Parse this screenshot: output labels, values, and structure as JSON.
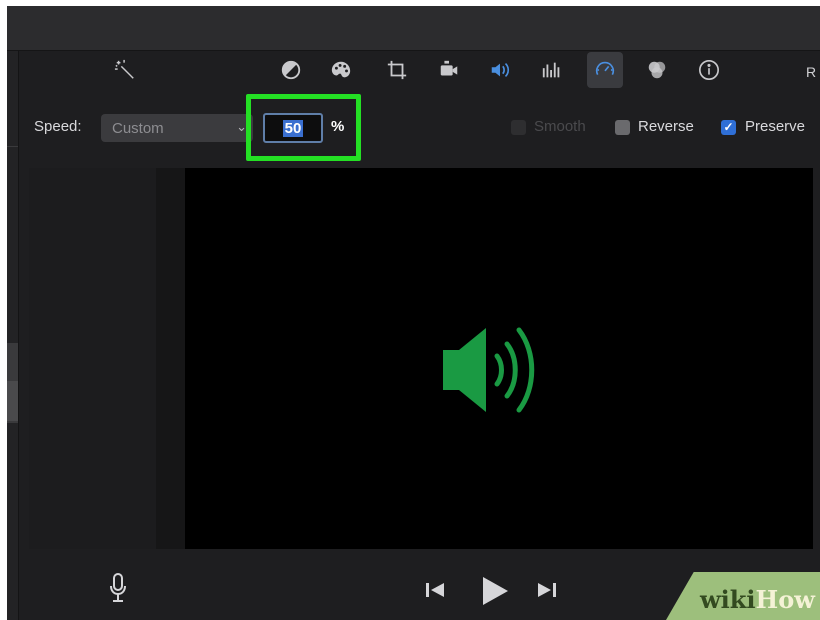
{
  "toolbar": {
    "icons": [
      "magic-wand-icon",
      "color-balance-icon",
      "color-palette-icon",
      "crop-icon",
      "stabilization-icon",
      "volume-icon",
      "equalizer-icon",
      "speed-icon",
      "noise-filter-icon",
      "info-icon"
    ],
    "active_icon": "speed-icon",
    "right_clipped_text": "R",
    "colors": {
      "accent": "#4a8fe0",
      "icon": "#c9c9cc"
    }
  },
  "speed": {
    "label": "Speed:",
    "preset": "Custom",
    "value": "50",
    "unit": "%",
    "smooth_label": "Smooth",
    "smooth_checked": false,
    "reverse_label": "Reverse",
    "reverse_checked": false,
    "preserve_label": "Preserve",
    "preserve_checked": true
  },
  "viewer": {
    "overlay_icon": "speaker-volume-icon",
    "overlay_color": "#1a9a43"
  },
  "playback": {
    "mic": "microphone-icon",
    "prev": "skip-back-icon",
    "play": "play-icon",
    "next": "skip-forward-icon"
  },
  "watermark": {
    "wiki": "wiki",
    "how": "How"
  },
  "highlight_color": "#24e024"
}
